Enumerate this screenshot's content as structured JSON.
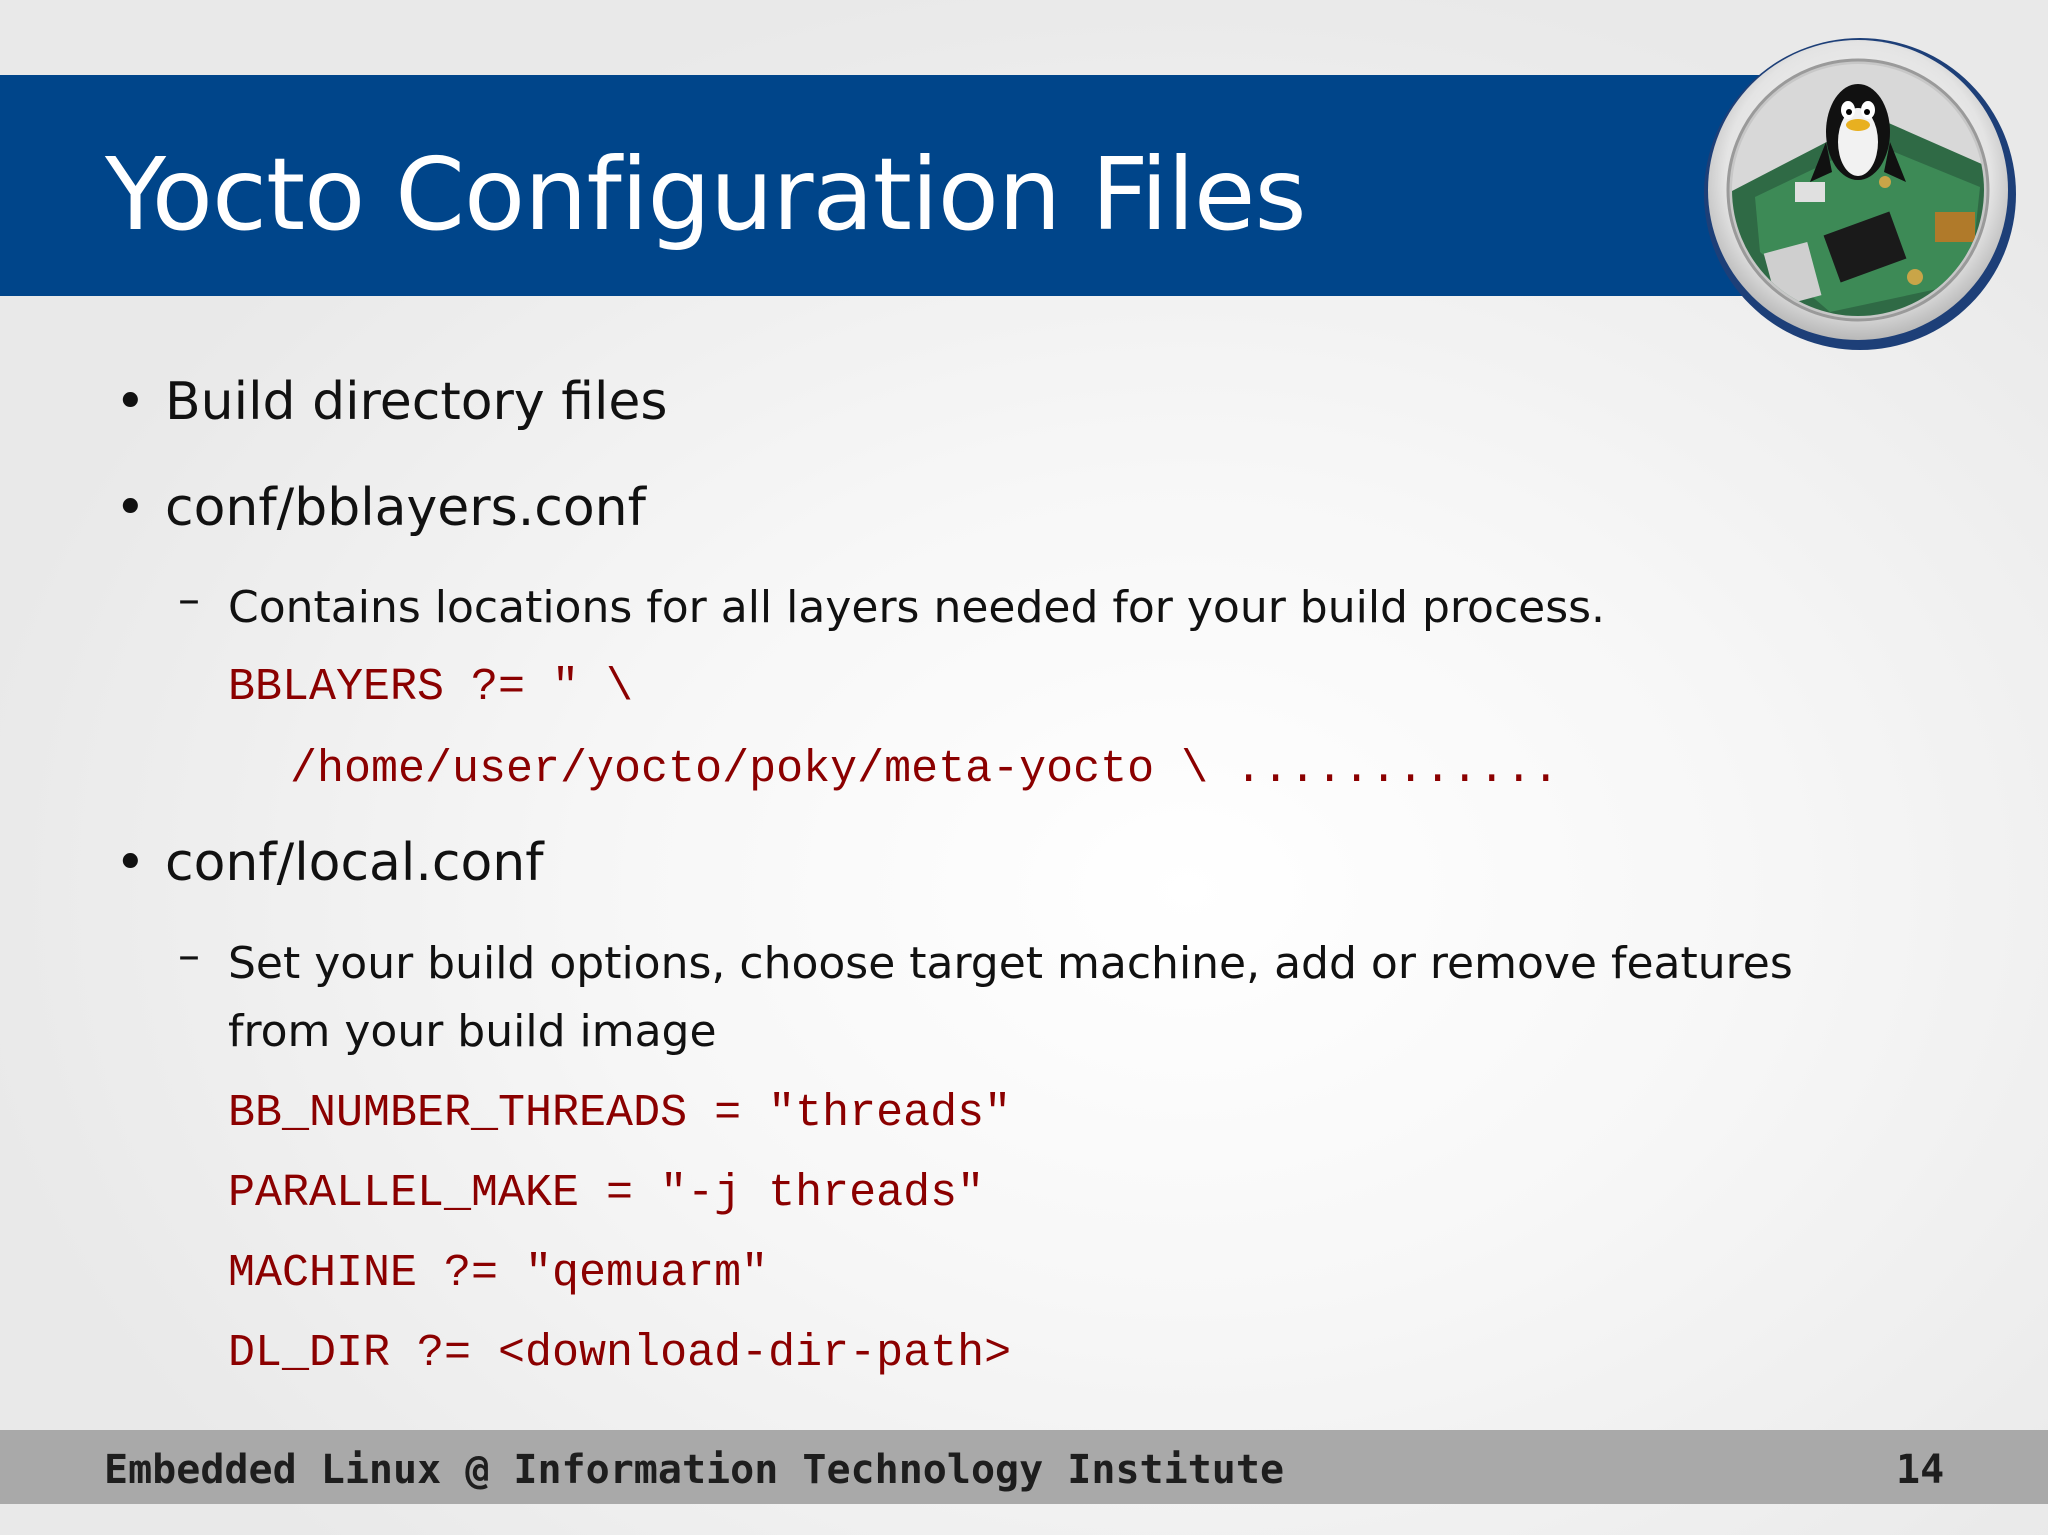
{
  "slide": {
    "title": "Yocto Configuration Files",
    "logo_icon": "tux-penguin-embedded-board-logo"
  },
  "content": {
    "b1": "Build directory files",
    "b2": "conf/bblayers.conf",
    "b2_sub": "Contains locations for all  layers needed for your build process.",
    "b2_code1": "BBLAYERS ?= \" \\",
    "b2_code2": "/home/user/yocto/poky/meta-yocto \\ ............",
    "b3": "conf/local.conf",
    "b3_sub_line1": "Set your build options, choose target machine, add or remove features",
    "b3_sub_line2": "from your build image",
    "b3_code1": "BB_NUMBER_THREADS = \"threads\"",
    "b3_code2": "PARALLEL_MAKE = \"-j threads\"",
    "b3_code3": "MACHINE ?= \"qemuarm\"",
    "b3_code4": "DL_DIR ?= <download-dir-path>"
  },
  "footer": {
    "text": "Embedded Linux @ Information Technology Institute",
    "page": "14"
  },
  "colors": {
    "title_bar": "#00458a",
    "code": "#8b0000",
    "footer_bar": "#a9a9a9"
  }
}
